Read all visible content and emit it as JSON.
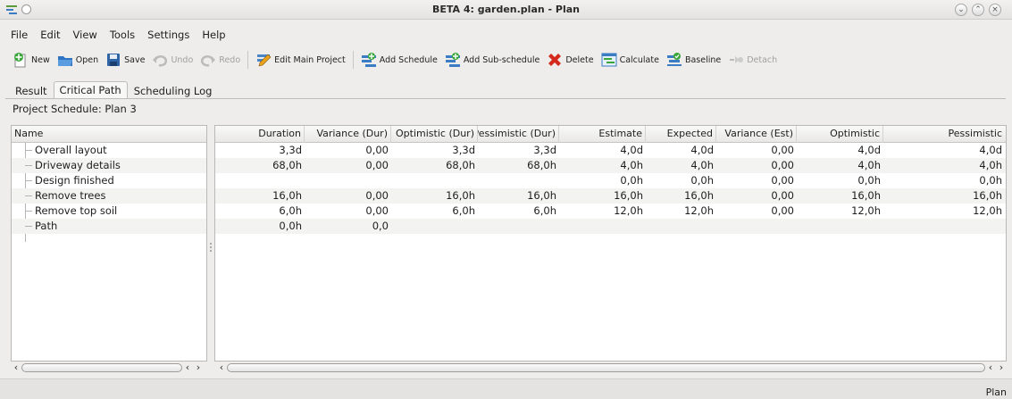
{
  "window": {
    "title": "BETA 4: garden.plan - Plan",
    "controls": [
      "minimize",
      "maximize",
      "close"
    ]
  },
  "menu": [
    "File",
    "Edit",
    "View",
    "Tools",
    "Settings",
    "Help"
  ],
  "toolbar": {
    "new": "New",
    "open": "Open",
    "save": "Save",
    "undo": "Undo",
    "redo": "Redo",
    "edit_main_project": "Edit Main Project",
    "add_schedule": "Add Schedule",
    "add_sub_schedule": "Add Sub-schedule",
    "delete": "Delete",
    "calculate": "Calculate",
    "baseline": "Baseline",
    "detach": "Detach"
  },
  "tabs": [
    "Result",
    "Critical Path",
    "Scheduling Log"
  ],
  "active_tab": "Critical Path",
  "project_schedule_label": "Project Schedule:  Plan 3",
  "table": {
    "name_header": "Name",
    "columns": [
      "Duration",
      "Variance (Dur)",
      "Optimistic (Dur)",
      "Pessimistic (Dur)",
      "Estimate",
      "Expected",
      "Variance (Est)",
      "Optimistic",
      "Pessimistic"
    ],
    "rows": [
      {
        "name": "Overall layout",
        "values": [
          "3,3d",
          "0,00",
          "3,3d",
          "3,3d",
          "4,0d",
          "4,0d",
          "0,00",
          "4,0d",
          "4,0d"
        ]
      },
      {
        "name": "Driveway details",
        "values": [
          "68,0h",
          "0,00",
          "68,0h",
          "68,0h",
          "4,0h",
          "4,0h",
          "0,00",
          "4,0h",
          "4,0h"
        ]
      },
      {
        "name": "Design finished",
        "values": [
          "",
          "",
          "",
          "",
          "0,0h",
          "0,0h",
          "0,00",
          "0,0h",
          "0,0h"
        ]
      },
      {
        "name": "Remove trees",
        "values": [
          "16,0h",
          "0,00",
          "16,0h",
          "16,0h",
          "16,0h",
          "16,0h",
          "0,00",
          "16,0h",
          "16,0h"
        ]
      },
      {
        "name": "Remove top soil",
        "values": [
          "6,0h",
          "0,00",
          "6,0h",
          "6,0h",
          "12,0h",
          "12,0h",
          "0,00",
          "12,0h",
          "12,0h"
        ]
      },
      {
        "name": "Path",
        "values": [
          "0,0h",
          "0,0",
          "",
          "",
          "",
          "",
          "",
          "",
          ""
        ]
      }
    ]
  },
  "status": "Plan",
  "colors": {
    "background": "#eeedeb",
    "selection_tab": "#f7f7f6",
    "delete_red": "#d42a1e",
    "save_blue": "#2f64a6"
  }
}
